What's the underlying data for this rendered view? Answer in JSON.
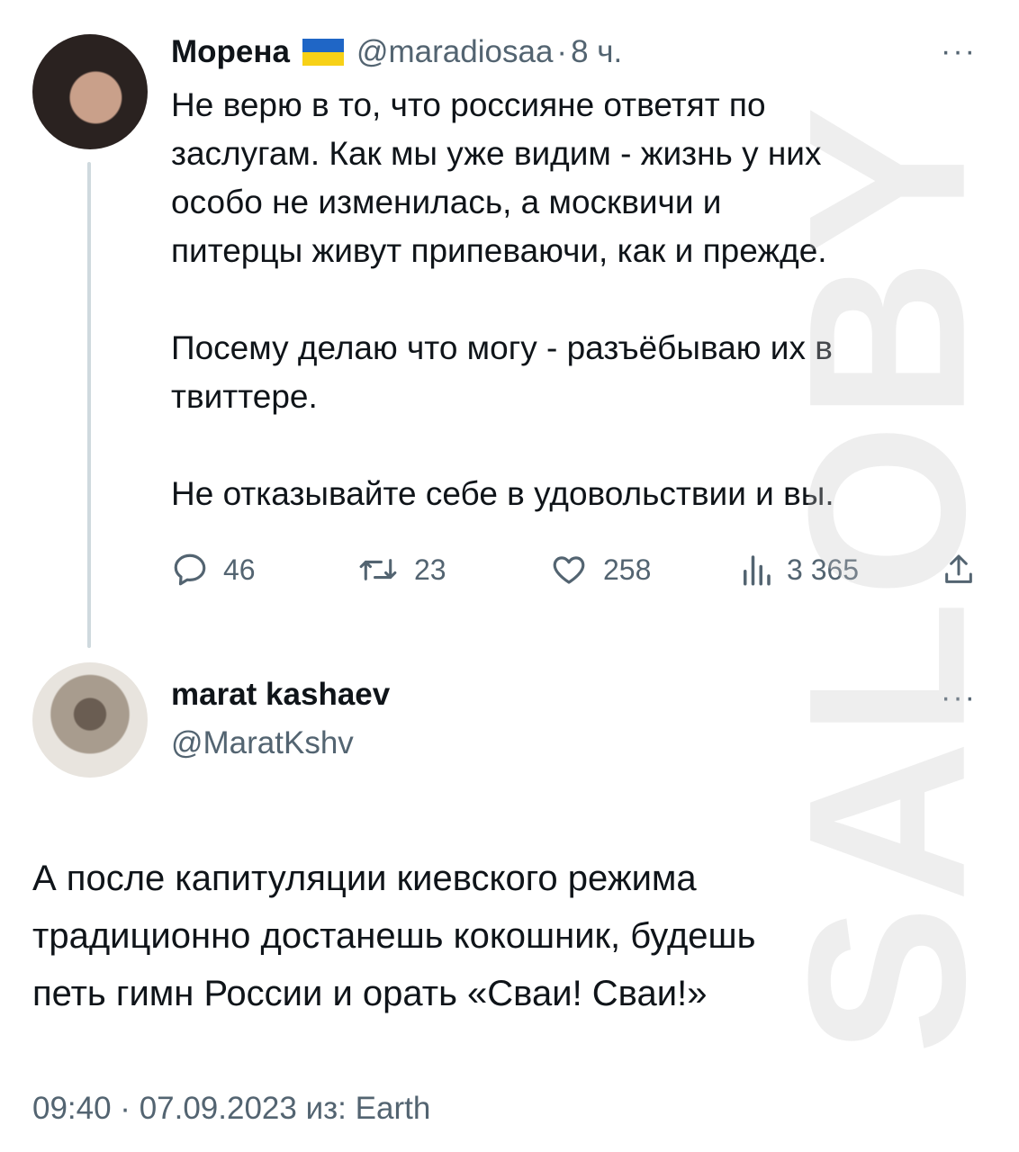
{
  "tweet1": {
    "author_name": "Морена",
    "handle": "@maradiosaa",
    "separator": "·",
    "time": "8 ч.",
    "more_label": "···",
    "text": "Не верю в то, что россияне ответят по\nзаслугам. Как мы уже видим - жизнь у них\nособо не изменилась, а москвичи и\nпитерцы живут припеваючи, как и прежде.\n\nПосему делаю что могу - разъёбываю их в\nтвиттере.\n\nНе отказывайте себе в удовольствии и вы.",
    "stats": {
      "replies": "46",
      "retweets": "23",
      "likes": "258",
      "views": "3 365"
    },
    "icons": {
      "reply": "reply-icon",
      "retweet": "retweet-icon",
      "like": "heart-icon",
      "views": "views-icon",
      "share": "share-icon"
    },
    "flag_colors": [
      "#1f66c6",
      "#f7d117"
    ]
  },
  "tweet2": {
    "author_name": "marat kashaev",
    "handle": "@MaratKshv",
    "more_label": "···",
    "text": "А после капитуляции киевского режима\nтрадиционно достанешь кокошник, будешь\nпеть гимн России и орать «Сваи! Сваи!»",
    "meta": "09:40 · 07.09.2023 из: Earth"
  },
  "watermark": "SALOBY",
  "colors": {
    "text": "#0f1419",
    "muted": "#536471",
    "thread_line": "#cfd9de"
  }
}
